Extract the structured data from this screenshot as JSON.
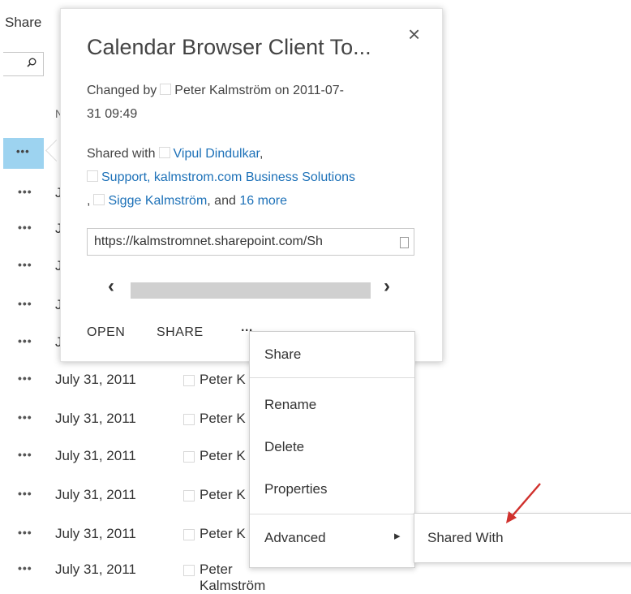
{
  "toolbar": {
    "share_label": "Share"
  },
  "list": {
    "ellipsis": "•••",
    "partial_letter": "J",
    "header_partial": "N",
    "rows": [
      {
        "date": "July 31, 2011",
        "name": "Peter K"
      },
      {
        "date": "July 31, 2011",
        "name": "Peter K"
      },
      {
        "date": "July 31, 2011",
        "name": "Peter K"
      },
      {
        "date": "July 31, 2011",
        "name": "Peter K"
      },
      {
        "date": "July 31, 2011",
        "name": "Peter K"
      },
      {
        "date": "July 31, 2011",
        "name": "Peter Kalmström"
      }
    ]
  },
  "callout": {
    "title": "Calendar Browser Client To...",
    "close": "×",
    "changed_by_prefix": "Changed by",
    "changed_by_name": "Peter Kalmström",
    "changed_on": "on 2011-07-",
    "changed_time": "31 09:49",
    "shared_with_prefix": "Shared with",
    "shared_person_1": "Vipul Dindulkar",
    "shared_person_2": "Support, kalmstrom.com Business Solutions",
    "shared_person_3": "Sigge Kalmström",
    "shared_and": ", and",
    "shared_more": "16 more",
    "url": "https://kalmstromnet.sharepoint.com/Sh",
    "scroll_left": "‹",
    "scroll_right": "›",
    "actions": {
      "open": "OPEN",
      "share": "SHARE",
      "more": "..."
    }
  },
  "context_menu": {
    "items": [
      "Share",
      "Rename",
      "Delete",
      "Properties",
      "Advanced"
    ],
    "advanced_arrow": "▸"
  },
  "submenu": {
    "item": "Shared With"
  },
  "annotation_color": "#d0312d"
}
